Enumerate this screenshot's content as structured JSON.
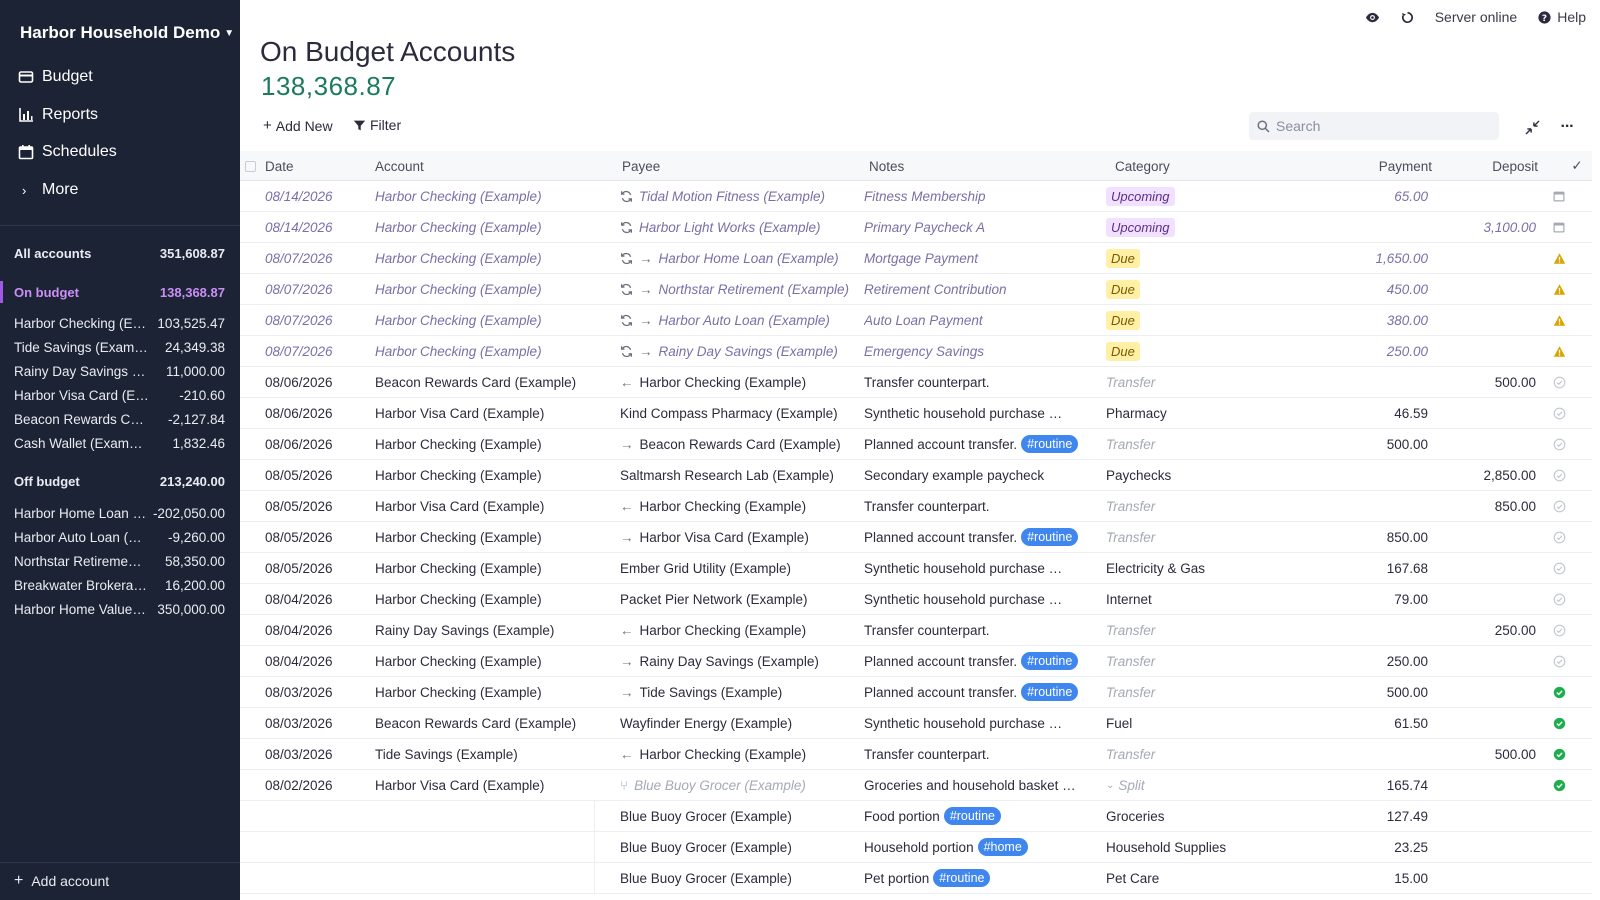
{
  "sidebar": {
    "budget_name": "Harbor Household Demo",
    "nav": [
      {
        "label": "Budget",
        "icon": "wallet-icon"
      },
      {
        "label": "Reports",
        "icon": "bar-chart-icon"
      },
      {
        "label": "Schedules",
        "icon": "calendar-icon"
      },
      {
        "label": "More",
        "icon": "chevron-right-icon"
      }
    ],
    "all_accounts": {
      "label": "All accounts",
      "value": "351,608.87"
    },
    "on_budget": {
      "label": "On budget",
      "value": "138,368.87"
    },
    "on_budget_accounts": [
      {
        "name": "Harbor Checking (Example)",
        "value": "103,525.47"
      },
      {
        "name": "Tide Savings (Example)",
        "value": "24,349.38"
      },
      {
        "name": "Rainy Day Savings (Example)",
        "value": "11,000.00"
      },
      {
        "name": "Harbor Visa Card (Example)",
        "value": "-210.60"
      },
      {
        "name": "Beacon Rewards Card (Example)",
        "value": "-2,127.84"
      },
      {
        "name": "Cash Wallet (Example)",
        "value": "1,832.46"
      }
    ],
    "off_budget": {
      "label": "Off budget",
      "value": "213,240.00"
    },
    "off_budget_accounts": [
      {
        "name": "Harbor Home Loan (Example)",
        "value": "-202,050.00"
      },
      {
        "name": "Harbor Auto Loan (Example)",
        "value": "-9,260.00"
      },
      {
        "name": "Northstar Retirement (Example)",
        "value": "58,350.00"
      },
      {
        "name": "Breakwater Brokerage (Example)",
        "value": "16,200.00"
      },
      {
        "name": "Harbor Home Value (Example)",
        "value": "350,000.00"
      }
    ],
    "add_account": "Add account"
  },
  "topbar": {
    "server_status": "Server online",
    "help": "Help"
  },
  "header": {
    "title": "On Budget Accounts",
    "balance": "138,368.87"
  },
  "toolbar": {
    "add_new": "Add New",
    "filter": "Filter",
    "search_placeholder": "Search"
  },
  "columns": {
    "date": "Date",
    "account": "Account",
    "payee": "Payee",
    "notes": "Notes",
    "category": "Category",
    "payment": "Payment",
    "deposit": "Deposit",
    "cleared": "✓"
  },
  "colors": {
    "sidebar_bg": "#1c2334",
    "accent_purple": "#a259e6",
    "balance_green": "#1c7b5f",
    "tag_blue": "#3f86ee",
    "cleared_green": "#1cad4d",
    "warning_amber": "#d9a400"
  },
  "transactions": [
    {
      "kind": "sched",
      "date": "08/14/2026",
      "account": "Harbor Checking (Example)",
      "payee": "Tidal Motion Fitness (Example)",
      "arrow": "",
      "notes": "Fitness Membership",
      "tag": "",
      "cat_pill": "Upcoming",
      "pill_type": "upcoming",
      "category": "",
      "payment": "65.00",
      "deposit": "",
      "status": "calendar"
    },
    {
      "kind": "sched",
      "date": "08/14/2026",
      "account": "Harbor Checking (Example)",
      "payee": "Harbor Light Works (Example)",
      "arrow": "",
      "notes": "Primary Paycheck A",
      "tag": "",
      "cat_pill": "Upcoming",
      "pill_type": "upcoming",
      "category": "",
      "payment": "",
      "deposit": "3,100.00",
      "status": "calendar"
    },
    {
      "kind": "sched",
      "date": "08/07/2026",
      "account": "Harbor Checking (Example)",
      "payee": "Harbor Home Loan (Example)",
      "arrow": "→",
      "notes": "Mortgage Payment",
      "tag": "",
      "cat_pill": "Due",
      "pill_type": "due",
      "category": "",
      "payment": "1,650.00",
      "deposit": "",
      "status": "warning"
    },
    {
      "kind": "sched",
      "date": "08/07/2026",
      "account": "Harbor Checking (Example)",
      "payee": "Northstar Retirement (Example)",
      "arrow": "→",
      "notes": "Retirement Contribution",
      "tag": "",
      "cat_pill": "Due",
      "pill_type": "due",
      "category": "",
      "payment": "450.00",
      "deposit": "",
      "status": "warning"
    },
    {
      "kind": "sched",
      "date": "08/07/2026",
      "account": "Harbor Checking (Example)",
      "payee": "Harbor Auto Loan (Example)",
      "arrow": "→",
      "notes": "Auto Loan Payment",
      "tag": "",
      "cat_pill": "Due",
      "pill_type": "due",
      "category": "",
      "payment": "380.00",
      "deposit": "",
      "status": "warning"
    },
    {
      "kind": "sched",
      "date": "08/07/2026",
      "account": "Harbor Checking (Example)",
      "payee": "Rainy Day Savings (Example)",
      "arrow": "→",
      "notes": "Emergency Savings",
      "tag": "",
      "cat_pill": "Due",
      "pill_type": "due",
      "category": "",
      "payment": "250.00",
      "deposit": "",
      "status": "warning"
    },
    {
      "kind": "normal",
      "date": "08/06/2026",
      "account": "Beacon Rewards Card (Example)",
      "payee": "Harbor Checking (Example)",
      "arrow": "←",
      "notes": "Transfer counterpart.",
      "tag": "",
      "cat_pill": "",
      "category": "Transfer",
      "cat_muted": true,
      "payment": "",
      "deposit": "500.00",
      "status": "uncleared"
    },
    {
      "kind": "normal",
      "date": "08/06/2026",
      "account": "Harbor Visa Card (Example)",
      "payee": "Kind Compass Pharmacy (Example)",
      "arrow": "",
      "notes": "Synthetic household purchase …",
      "tag": "",
      "cat_pill": "",
      "category": "Pharmacy",
      "payment": "46.59",
      "deposit": "",
      "status": "uncleared"
    },
    {
      "kind": "normal",
      "date": "08/06/2026",
      "account": "Harbor Checking (Example)",
      "payee": "Beacon Rewards Card (Example)",
      "arrow": "→",
      "notes": "Planned account transfer.",
      "tag": "#routine",
      "cat_pill": "",
      "category": "Transfer",
      "cat_muted": true,
      "payment": "500.00",
      "deposit": "",
      "status": "uncleared"
    },
    {
      "kind": "normal",
      "date": "08/05/2026",
      "account": "Harbor Checking (Example)",
      "payee": "Saltmarsh Research Lab (Example)",
      "arrow": "",
      "notes": "Secondary example paycheck",
      "tag": "",
      "cat_pill": "",
      "category": "Paychecks",
      "payment": "",
      "deposit": "2,850.00",
      "status": "uncleared"
    },
    {
      "kind": "normal",
      "date": "08/05/2026",
      "account": "Harbor Visa Card (Example)",
      "payee": "Harbor Checking (Example)",
      "arrow": "←",
      "notes": "Transfer counterpart.",
      "tag": "",
      "cat_pill": "",
      "category": "Transfer",
      "cat_muted": true,
      "payment": "",
      "deposit": "850.00",
      "status": "uncleared"
    },
    {
      "kind": "normal",
      "date": "08/05/2026",
      "account": "Harbor Checking (Example)",
      "payee": "Harbor Visa Card (Example)",
      "arrow": "→",
      "notes": "Planned account transfer.",
      "tag": "#routine",
      "cat_pill": "",
      "category": "Transfer",
      "cat_muted": true,
      "payment": "850.00",
      "deposit": "",
      "status": "uncleared"
    },
    {
      "kind": "normal",
      "date": "08/05/2026",
      "account": "Harbor Checking (Example)",
      "payee": "Ember Grid Utility (Example)",
      "arrow": "",
      "notes": "Synthetic household purchase …",
      "tag": "",
      "cat_pill": "",
      "category": "Electricity & Gas",
      "payment": "167.68",
      "deposit": "",
      "status": "uncleared"
    },
    {
      "kind": "normal",
      "date": "08/04/2026",
      "account": "Harbor Checking (Example)",
      "payee": "Packet Pier Network (Example)",
      "arrow": "",
      "notes": "Synthetic household purchase …",
      "tag": "",
      "cat_pill": "",
      "category": "Internet",
      "payment": "79.00",
      "deposit": "",
      "status": "uncleared"
    },
    {
      "kind": "normal",
      "date": "08/04/2026",
      "account": "Rainy Day Savings (Example)",
      "payee": "Harbor Checking (Example)",
      "arrow": "←",
      "notes": "Transfer counterpart.",
      "tag": "",
      "cat_pill": "",
      "category": "Transfer",
      "cat_muted": true,
      "payment": "",
      "deposit": "250.00",
      "status": "uncleared"
    },
    {
      "kind": "normal",
      "date": "08/04/2026",
      "account": "Harbor Checking (Example)",
      "payee": "Rainy Day Savings (Example)",
      "arrow": "→",
      "notes": "Planned account transfer.",
      "tag": "#routine",
      "cat_pill": "",
      "category": "Transfer",
      "cat_muted": true,
      "payment": "250.00",
      "deposit": "",
      "status": "uncleared"
    },
    {
      "kind": "normal",
      "date": "08/03/2026",
      "account": "Harbor Checking (Example)",
      "payee": "Tide Savings (Example)",
      "arrow": "→",
      "notes": "Planned account transfer.",
      "tag": "#routine",
      "cat_pill": "",
      "category": "Transfer",
      "cat_muted": true,
      "payment": "500.00",
      "deposit": "",
      "status": "cleared"
    },
    {
      "kind": "normal",
      "date": "08/03/2026",
      "account": "Beacon Rewards Card (Example)",
      "payee": "Wayfinder Energy (Example)",
      "arrow": "",
      "notes": "Synthetic household purchase …",
      "tag": "",
      "cat_pill": "",
      "category": "Fuel",
      "payment": "61.50",
      "deposit": "",
      "status": "cleared"
    },
    {
      "kind": "normal",
      "date": "08/03/2026",
      "account": "Tide Savings (Example)",
      "payee": "Harbor Checking (Example)",
      "arrow": "←",
      "notes": "Transfer counterpart.",
      "tag": "",
      "cat_pill": "",
      "category": "Transfer",
      "cat_muted": true,
      "payment": "",
      "deposit": "500.00",
      "status": "cleared"
    },
    {
      "kind": "parent",
      "date": "08/02/2026",
      "account": "Harbor Visa Card (Example)",
      "payee": "Blue Buoy Grocer (Example)",
      "arrow": "",
      "notes": "Groceries and household basket …",
      "tag": "",
      "cat_pill": "",
      "category": "Split",
      "cat_muted": true,
      "payment": "165.74",
      "deposit": "",
      "status": "cleared"
    },
    {
      "kind": "sub",
      "date": "",
      "account": "",
      "payee": "Blue Buoy Grocer (Example)",
      "arrow": "",
      "notes": "Food portion",
      "tag": "#routine",
      "cat_pill": "",
      "category": "Groceries",
      "payment": "127.49",
      "deposit": "",
      "status": ""
    },
    {
      "kind": "sub",
      "date": "",
      "account": "",
      "payee": "Blue Buoy Grocer (Example)",
      "arrow": "",
      "notes": "Household portion",
      "tag": "#home",
      "cat_pill": "",
      "category": "Household Supplies",
      "payment": "23.25",
      "deposit": "",
      "status": ""
    },
    {
      "kind": "sub",
      "date": "",
      "account": "",
      "payee": "Blue Buoy Grocer (Example)",
      "arrow": "",
      "notes": "Pet portion",
      "tag": "#routine",
      "cat_pill": "",
      "category": "Pet Care",
      "payment": "15.00",
      "deposit": "",
      "status": ""
    }
  ]
}
